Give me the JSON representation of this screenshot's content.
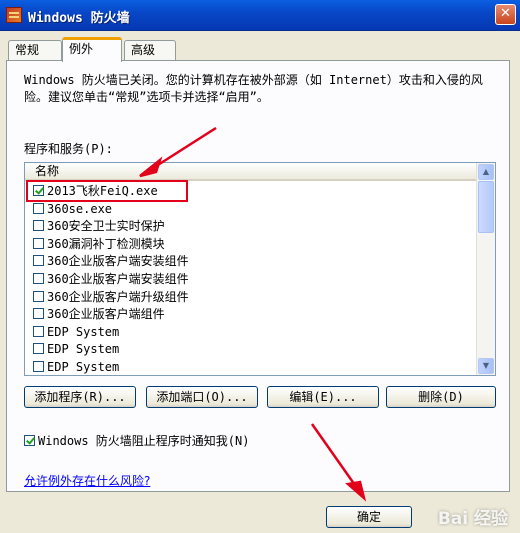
{
  "window": {
    "title": "Windows 防火墙",
    "close_glyph": "✕"
  },
  "tabs": [
    {
      "label": "常规",
      "active": false
    },
    {
      "label": "例外",
      "active": true
    },
    {
      "label": "高级",
      "active": false
    }
  ],
  "info_text": "Windows 防火墙已关闭。您的计算机存在被外部源（如 Internet）攻击和入侵的风险。建议您单击“常规”选项卡并选择“启用”。",
  "programs": {
    "label": "程序和服务(P):",
    "column_header": "名称",
    "items": [
      {
        "name": "2013飞秋FeiQ.exe",
        "checked": true
      },
      {
        "name": "360se.exe",
        "checked": false
      },
      {
        "name": "360安全卫士实时保护",
        "checked": false
      },
      {
        "name": "360漏洞补丁检测模块",
        "checked": false
      },
      {
        "name": "360企业版客户端安装组件",
        "checked": false
      },
      {
        "name": "360企业版客户端安装组件",
        "checked": false
      },
      {
        "name": "360企业版客户端升级组件",
        "checked": false
      },
      {
        "name": "360企业版客户端组件",
        "checked": false
      },
      {
        "name": "EDP System",
        "checked": false
      },
      {
        "name": "EDP System",
        "checked": false
      },
      {
        "name": "EDP System",
        "checked": false
      }
    ]
  },
  "buttons": {
    "add_program": "添加程序(R)...",
    "add_port": "添加端口(O)...",
    "edit": "编辑(E)...",
    "delete": "删除(D)",
    "ok": "确定"
  },
  "notify": {
    "label": "Windows 防火墙阻止程序时通知我(N)",
    "checked": true
  },
  "risk_link": "允许例外存在什么风险?",
  "watermark": "Bai 经验",
  "colors": {
    "annotation_red": "#e3001b",
    "title_blue": "#0848c8"
  }
}
